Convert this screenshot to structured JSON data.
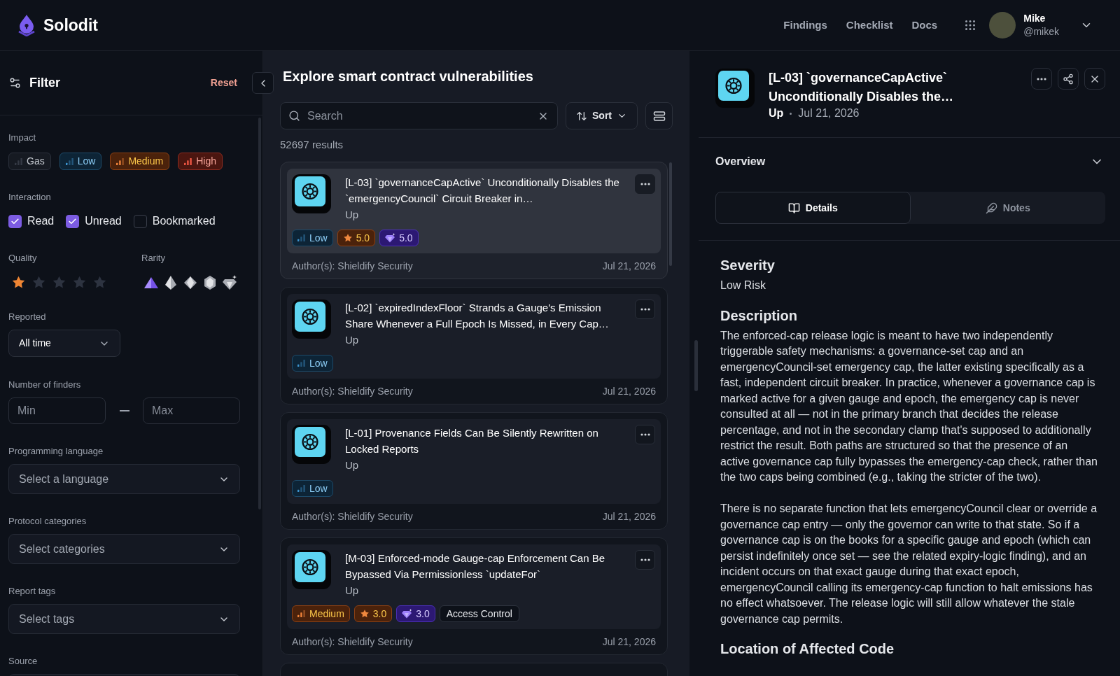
{
  "header": {
    "brand": "Solodit",
    "nav": [
      {
        "label": "Findings"
      },
      {
        "label": "Checklist"
      },
      {
        "label": "Docs"
      }
    ],
    "user": {
      "name": "Mike",
      "handle": "@mikek"
    }
  },
  "filter": {
    "title": "Filter",
    "reset": "Reset",
    "impact": {
      "label": "Impact",
      "chips": [
        {
          "label": "Gas",
          "kind": "gas"
        },
        {
          "label": "Low",
          "kind": "low"
        },
        {
          "label": "Medium",
          "kind": "medium"
        },
        {
          "label": "High",
          "kind": "high"
        }
      ]
    },
    "interaction": {
      "label": "Interaction",
      "options": [
        {
          "label": "Read",
          "checked": true
        },
        {
          "label": "Unread",
          "checked": true
        },
        {
          "label": "Bookmarked",
          "checked": false
        }
      ]
    },
    "quality": {
      "label": "Quality",
      "stars": 1
    },
    "rarity": {
      "label": "Rarity",
      "gems": [
        {
          "kind": "triangle",
          "selected": true
        },
        {
          "kind": "pyramid",
          "selected": false
        },
        {
          "kind": "octahedron",
          "selected": false
        },
        {
          "kind": "hexagon",
          "selected": false
        },
        {
          "kind": "diamond",
          "selected": false
        }
      ]
    },
    "reported": {
      "label": "Reported",
      "value": "All time"
    },
    "finders": {
      "label": "Number of finders",
      "min": {
        "placeholder": "Min"
      },
      "max": {
        "placeholder": "Max"
      }
    },
    "selects": [
      {
        "label": "Programming language",
        "placeholder": "Select a language"
      },
      {
        "label": "Protocol categories",
        "placeholder": "Select categories"
      },
      {
        "label": "Report tags",
        "placeholder": "Select tags"
      },
      {
        "label": "Source"
      }
    ]
  },
  "results": {
    "title": "Explore smart contract vulnerabilities",
    "search": {
      "placeholder": "Search"
    },
    "sort": "Sort",
    "count": "52697 results",
    "findings": [
      {
        "title": "[L-03] `governanceCapActive` Unconditionally Disables the `emergencyCouncil` Circuit Breaker in…",
        "protocol": "Up",
        "selected": true,
        "badges": [
          {
            "kind": "low",
            "label": "Low"
          },
          {
            "kind": "quality",
            "label": "5.0"
          },
          {
            "kind": "rarity",
            "label": "5.0"
          }
        ],
        "authors": "Author(s): Shieldify Security",
        "date": "Jul 21, 2026"
      },
      {
        "title": "[L-02] `expiredIndexFloor` Strands a Gauge's Emission Share Whenever a Full Epoch Is Missed, in Every Cap…",
        "protocol": "Up",
        "selected": false,
        "badges": [
          {
            "kind": "low",
            "label": "Low"
          }
        ],
        "authors": "Author(s): Shieldify Security",
        "date": "Jul 21, 2026"
      },
      {
        "title": "[L-01] Provenance Fields Can Be Silently Rewritten on Locked Reports",
        "protocol": "Up",
        "selected": false,
        "badges": [
          {
            "kind": "low",
            "label": "Low"
          }
        ],
        "authors": "Author(s): Shieldify Security",
        "date": "Jul 21, 2026"
      },
      {
        "title": "[M-03] Enforced-mode Gauge-cap Enforcement Can Be Bypassed Via Permissionless `updateFor`",
        "protocol": "Up",
        "selected": false,
        "badges": [
          {
            "kind": "medium",
            "label": "Medium"
          },
          {
            "kind": "quality",
            "label": "3.0"
          },
          {
            "kind": "rarity",
            "label": "3.0"
          },
          {
            "kind": "tag",
            "label": "Access Control"
          }
        ],
        "authors": "Author(s): Shieldify Security",
        "date": "Jul 21, 2026"
      }
    ]
  },
  "detail": {
    "title": "[L-03] `governanceCapActive` Unconditionally Disables the…",
    "protocol": "Up",
    "date": "Jul 21, 2026",
    "overview": "Overview",
    "tabs": [
      {
        "label": "Details",
        "kind": "details",
        "selected": true
      },
      {
        "label": "Notes",
        "kind": "notes",
        "selected": false
      }
    ],
    "sections": [
      {
        "heading": "Severity",
        "paragraphs": [
          "Low Risk"
        ]
      },
      {
        "heading": "Description",
        "paragraphs": [
          "The enforced-cap release logic is meant to have two independently triggerable safety mechanisms: a governance-set cap and an emergencyCouncil-set emergency cap, the latter existing specifically as a fast, independent circuit breaker. In practice, whenever a governance cap is marked active for a given gauge and epoch, the emergency cap is never consulted at all — not in the primary branch that decides the release percentage, and not in the secondary clamp that's supposed to additionally restrict the result. Both paths are structured so that the presence of an active governance cap fully bypasses the emergency-cap check, rather than the two caps being combined (e.g., taking the stricter of the two).",
          "There is no separate function that lets emergencyCouncil clear or override a governance cap entry — only the governor can write to that state. So if a governance cap is on the books for a specific gauge and epoch (which can persist indefinitely once set — see the related expiry-logic finding), and an incident occurs on that exact gauge during that exact epoch, emergencyCouncil calling its emergency-cap function to halt emissions has no effect whatsoever. The release logic will still allow whatever the stale governance cap permits."
        ]
      },
      {
        "heading": "Location of Affected Code"
      }
    ]
  }
}
